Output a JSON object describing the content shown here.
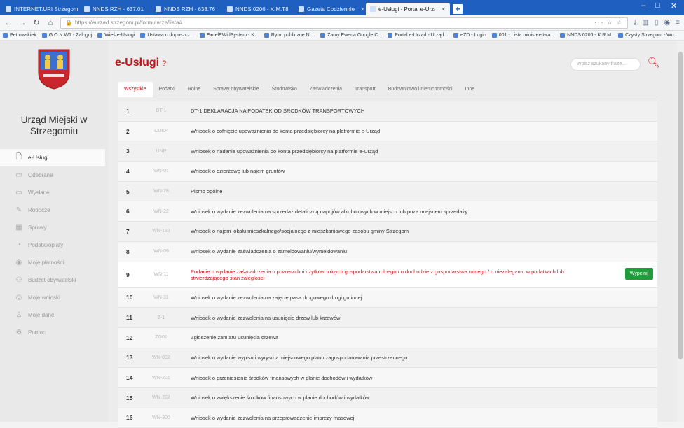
{
  "browser": {
    "tabs": [
      {
        "label": "INTERNET.URI Strzegom",
        "active": false
      },
      {
        "label": "NNDS RZH - 637.01",
        "active": false
      },
      {
        "label": "NNDS RZH - 638.76",
        "active": false
      },
      {
        "label": "NNDS 0206 - K.M.T8",
        "active": false
      },
      {
        "label": "Gazeta Codziennie",
        "active": false
      },
      {
        "label": "e-Usługi - Portal e-Urząd - Urz...",
        "active": true
      }
    ],
    "url": "https://eurzad.strzegom.pl/formularze/lista#",
    "url_actions": "··· ☆ ☆",
    "bookmarks": [
      "Petrowskiek",
      "G.O.N.W1 - Zaloguj",
      "Wieś e-Usługi",
      "Ustawa o dopuszcz...",
      "ExcelEWidSystem - K...",
      "Rytm publiczne Ni...",
      "Zamy Ewena Google C...",
      "Portal e-Urząd - Urząd...",
      "eZD - Login",
      "001 - Lista ministerstwa...",
      "NNDS 0206 - K.R.M.",
      "Czysty Strzegom - Wo..."
    ]
  },
  "sidebar": {
    "city_name": "Urząd Miejski w Strzegomiu",
    "items": [
      {
        "label": "e-Usługi",
        "icon": "document-icon"
      },
      {
        "label": "Odebrane",
        "icon": "inbox-icon"
      },
      {
        "label": "Wysłane",
        "icon": "outbox-icon"
      },
      {
        "label": "Robocze",
        "icon": "pencil-icon"
      },
      {
        "label": "Sprawy",
        "icon": "briefcase-icon"
      },
      {
        "label": "Podatki/opłaty",
        "icon": "coin-icon"
      },
      {
        "label": "Moje płatności",
        "icon": "payment-icon"
      },
      {
        "label": "Budżet obywatelski",
        "icon": "people-icon"
      },
      {
        "label": "Moje wnioski",
        "icon": "forms-icon"
      },
      {
        "label": "Moje dane",
        "icon": "user-icon"
      },
      {
        "label": "Pomoc",
        "icon": "help-icon"
      }
    ]
  },
  "main": {
    "title": "e-Usługi",
    "title_help": "?",
    "search_placeholder": "Wpisz szukany fraze...",
    "tabs": [
      "Wszystkie",
      "Podatki",
      "Rolne",
      "Sprawy obywatelskie",
      "Środowisko",
      "Zaświadczenia",
      "Transport",
      "Budownictwo i nieruchomości",
      "Inne"
    ],
    "apply_label": "Wypełnij",
    "rows": [
      {
        "num": "1",
        "code": "DT-1",
        "name": "DT-1 DEKLARACJA NA PODATEK OD ŚRODKÓW TRANSPORTOWYCH"
      },
      {
        "num": "2",
        "code": "CUKP",
        "name": "Wniosek o cofnięcie upoważnienia do konta przedsiębiorcy na platformie e-Urząd"
      },
      {
        "num": "3",
        "code": "UNP",
        "name": "Wniosek o nadanie upoważnienia do konta przedsiębiorcy na platformie e-Urząd"
      },
      {
        "num": "4",
        "code": "WN-01",
        "name": "Wniosek o dzierżawę lub najem gruntów"
      },
      {
        "num": "5",
        "code": "WN-78",
        "name": "Pismo ogólne"
      },
      {
        "num": "6",
        "code": "WN-22",
        "name": "Wniosek o wydanie zezwolenia na sprzedaż detaliczną napojów alkoholowych w miejscu lub poza miejscem sprzedaży"
      },
      {
        "num": "7",
        "code": "WN-183",
        "name": "Wniosek o najem lokalu mieszkalnego/socjalnego z mieszkaniowego zasobu gminy Strzegom"
      },
      {
        "num": "8",
        "code": "WN-09",
        "name": "Wniosek o wydanie zaświadczenia o zameldowaniu/wymeldowaniu"
      },
      {
        "num": "9",
        "code": "WN-11",
        "name": "Podanie o wydanie zaświadczenia o powierzchni użytków rolnych gospodarstwa rolnego / o dochodzie z gospodarstwa rolnego / o niezaleganiu w podatkach lub stwierdzającego stan zaległości",
        "highlight": true
      },
      {
        "num": "10",
        "code": "WN-31",
        "name": "Wniosek o wydanie zezwolenia na zajęcie pasa drogowego drogi gminnej"
      },
      {
        "num": "11",
        "code": "Z-1",
        "name": "Wniosek o wydanie zezwolenia na usunięcie drzew lub krzewów"
      },
      {
        "num": "12",
        "code": "ZG01",
        "name": "Zgłoszenie zamiaru usunięcia drzewa"
      },
      {
        "num": "13",
        "code": "WN-002",
        "name": "Wniosek o wydanie wypisu i wyrysu z miejscowego planu zagospodarowania przestrzennego"
      },
      {
        "num": "14",
        "code": "WN-201",
        "name": "Wniosek o przeniesienie środków finansowych w planie dochodów i wydatków"
      },
      {
        "num": "15",
        "code": "WN-202",
        "name": "Wniosek o zwiększenie środków finansowych w planie dochodów i wydatków"
      },
      {
        "num": "16",
        "code": "WN-300",
        "name": "Wniosek o wydanie zezwolenia na przeprowadzenie imprezy masowej"
      }
    ]
  },
  "colors": {
    "accent": "#c0161b",
    "apply_button": "#1f9d3a",
    "browser_tabbar": "#1f5fbf"
  }
}
